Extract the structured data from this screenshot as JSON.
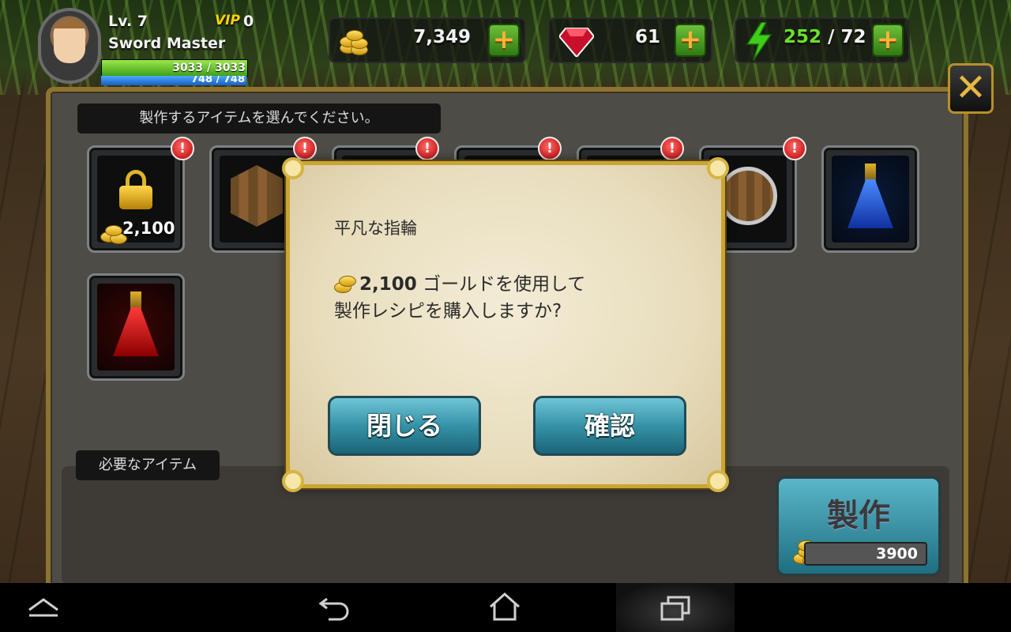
{
  "hud": {
    "level": "Lv. 7",
    "class_name": "Sword Master",
    "vip_label": "VIP",
    "vip_level": "0",
    "hp_text": "3033 / 3033",
    "hp_fraction": 1.0,
    "mp_text": "748 / 748",
    "mp_fraction": 1.0
  },
  "resources": {
    "gold": "7,349",
    "gems": "61",
    "energy_current": "252",
    "energy_separator": " / ",
    "energy_max": "72",
    "plus_label": "+"
  },
  "close_label": "✕",
  "craft_panel": {
    "header": "製作するアイテムを選んでください。",
    "badge_text": "!",
    "items": [
      {
        "name": "lock-ring",
        "price": "2,100",
        "badge": true
      },
      {
        "name": "wooden-shield",
        "badge": true
      },
      {
        "name": "hidden-item-3",
        "badge": true
      },
      {
        "name": "hidden-item-4",
        "badge": true
      },
      {
        "name": "hidden-item-5",
        "badge": true
      },
      {
        "name": "round-shield",
        "badge": true
      },
      {
        "name": "blue-potion",
        "badge": false
      },
      {
        "name": "red-potion",
        "badge": false
      }
    ],
    "required_label": "必要なアイテム",
    "craft_button": "製作",
    "craft_cost": "3900"
  },
  "dialog": {
    "item_name": "平凡な指輪",
    "price": "2,100",
    "message_line1": " ゴールドを使用して",
    "message_line2": "製作レシピを購入しますか?",
    "close_button": "閉じる",
    "confirm_button": "確認"
  },
  "colors": {
    "gold": "#e0b22c",
    "button_teal": "#3592a6",
    "badge_red": "#d01010",
    "energy_green": "#6be02c"
  },
  "nav": {
    "up_icon": "chevron-up-icon",
    "back_icon": "back-icon",
    "home_icon": "home-icon",
    "recent_icon": "recent-apps-icon"
  }
}
